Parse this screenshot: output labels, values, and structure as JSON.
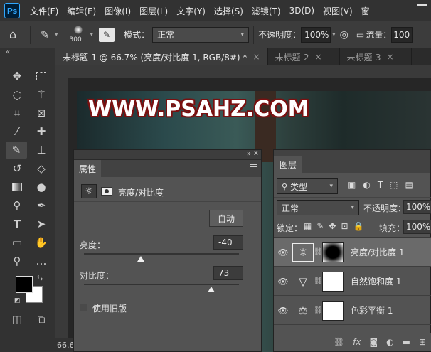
{
  "app": {
    "logo": "Ps"
  },
  "menu": [
    "文件(F)",
    "编辑(E)",
    "图像(I)",
    "图层(L)",
    "文字(Y)",
    "选择(S)",
    "滤镜(T)",
    "3D(D)",
    "视图(V)",
    "窗"
  ],
  "options": {
    "brush_size": "300",
    "mode_label": "模式：",
    "mode_value": "正常",
    "opacity_label": "不透明度：",
    "opacity_value": "100%",
    "flow_label": "流量：",
    "flow_value": "100"
  },
  "tabs": [
    {
      "label": "未标题-1 @ 66.7% (亮度/对比度 1, RGB/8#) *",
      "close": "×"
    },
    {
      "label": "未标题-2",
      "close": "×"
    },
    {
      "label": "未标题-3",
      "close": "×"
    }
  ],
  "canvas": {
    "watermark": "WWW.PSAHZ.COM",
    "zoom": "66.6"
  },
  "properties": {
    "tab": "属性",
    "adjustment_title": "亮度/对比度",
    "auto_button": "自动",
    "brightness_label": "亮度：",
    "brightness_value": "-40",
    "brightness_level": -40,
    "contrast_label": "对比度：",
    "contrast_value": "73",
    "contrast_level": 73,
    "legacy_label": "使用旧版",
    "legacy_checked": false
  },
  "layers": {
    "tab": "图层",
    "filter_label": "类型",
    "blend_mode": "正常",
    "opacity_label": "不透明度：",
    "opacity_value": "100%",
    "lock_label": "锁定：",
    "fill_label": "填充：",
    "fill_value": "100%",
    "items": [
      {
        "name": "亮度/对比度 1",
        "icon": "brightness-icon",
        "selected": true
      },
      {
        "name": "自然饱和度 1",
        "icon": "vibrance-icon",
        "selected": false
      },
      {
        "name": "色彩平衡 1",
        "icon": "color-balance-icon",
        "selected": false
      }
    ]
  },
  "colors": {
    "foreground": "#000000",
    "background": "#ffffff",
    "accent": "#31a8ff",
    "watermark_outline": "#7a1010"
  }
}
